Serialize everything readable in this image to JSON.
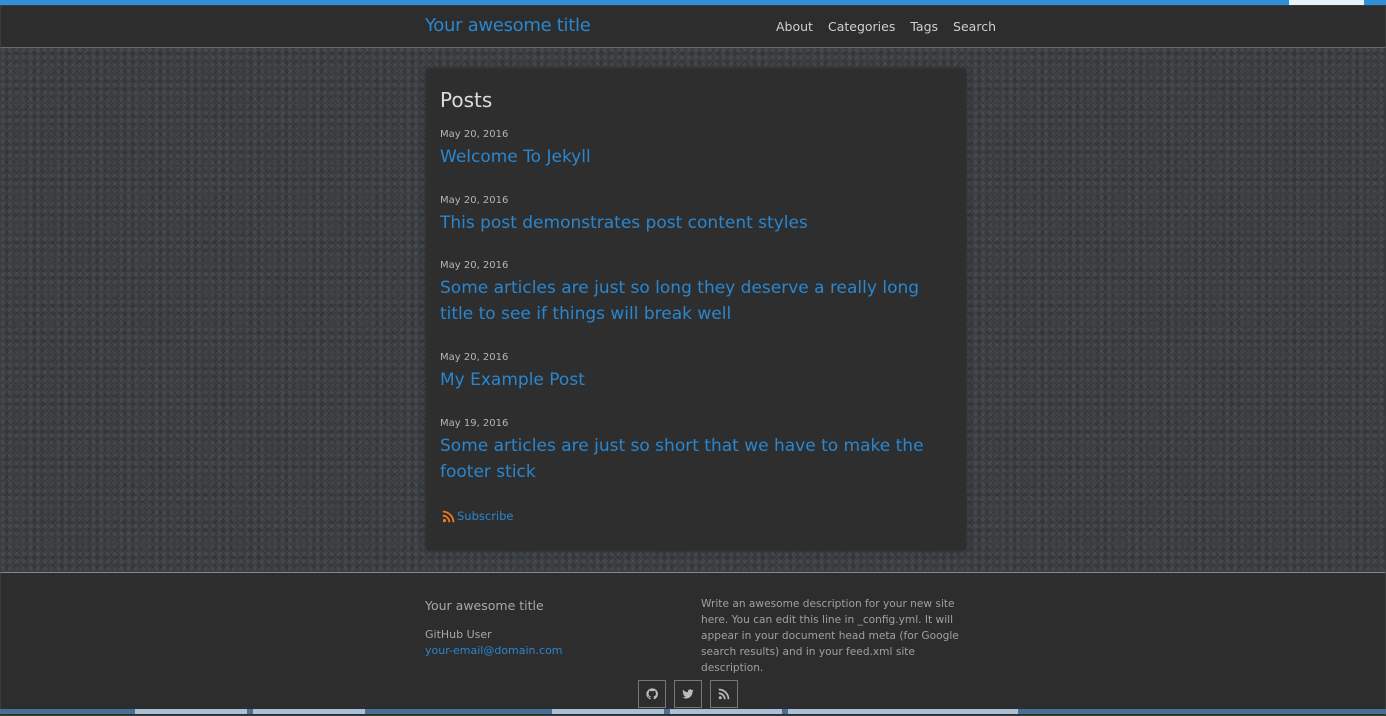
{
  "header": {
    "site_title": "Your awesome title",
    "nav": [
      "About",
      "Categories",
      "Tags",
      "Search"
    ]
  },
  "main": {
    "heading": "Posts",
    "posts": [
      {
        "date": "May 20, 2016",
        "title": "Welcome To Jekyll"
      },
      {
        "date": "May 20, 2016",
        "title": "This post demonstrates post content styles"
      },
      {
        "date": "May 20, 2016",
        "title": "Some articles are just so long they deserve a really long title to see if things will break well"
      },
      {
        "date": "May 20, 2016",
        "title": "My Example Post"
      },
      {
        "date": "May 19, 2016",
        "title": "Some articles are just so short that we have to make the footer stick"
      }
    ],
    "subscribe_label": "Subscribe"
  },
  "footer": {
    "title": "Your awesome title",
    "user": "GitHub User",
    "email": "your-email@domain.com",
    "description": "Write an awesome description for your new site here. You can edit this line in _config.yml. It will appear in your document head meta (for Google search results) and in your feed.xml site description.",
    "social_icons": [
      "github-icon",
      "twitter-icon",
      "rss-icon"
    ]
  },
  "colors": {
    "accent": "#2a86cf",
    "panel": "#2e2e2e",
    "rss": "#f07a1f"
  }
}
